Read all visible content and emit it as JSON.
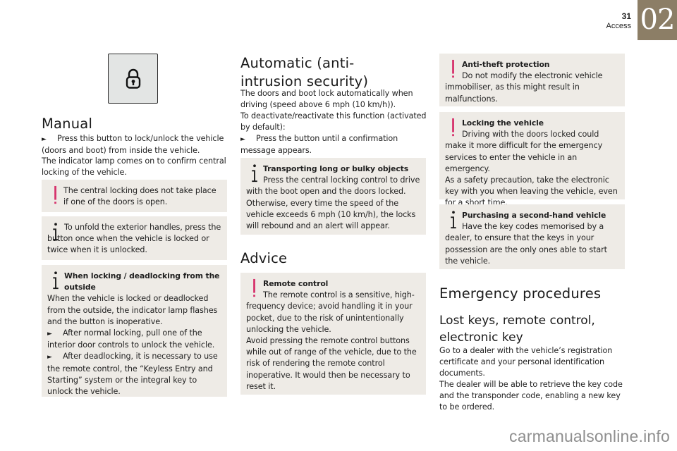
{
  "header": {
    "page_number": "31",
    "section": "Access",
    "chapter": "02"
  },
  "colors": {
    "chapter_tab": "#8c7e66",
    "box_background": "#eeebe6",
    "warning_icon": "#d6336c",
    "button_background": "#e3e5e4"
  },
  "icons": {
    "lock_button": "padlock-icon",
    "warning": "exclamation-icon",
    "info": "info-icon",
    "bullet": "triangle-right-icon"
  },
  "col1": {
    "heading": "Manual",
    "p1_bullet": "►",
    "p1": "Press this button to lock/unlock the vehicle (doors and boot) from inside the vehicle.",
    "p2": "The indicator lamp comes on to confirm central locking of the vehicle.",
    "warn1": "The central locking does not take place if one of the doors is open.",
    "info1": "To unfold the exterior handles, press the button once when the vehicle is locked or twice when it is unlocked.",
    "info2_title": "When locking / deadlocking from the outside",
    "info2_p1": "When the vehicle is locked or deadlocked from the outside, the indicator lamp flashes and the button is inoperative.",
    "info2_p2": "After normal locking, pull one of the interior door controls to unlock the vehicle.",
    "info2_p3": "After deadlocking, it is necessary to use the remote control, the “Keyless Entry and Starting” system or the integral key to unlock the vehicle."
  },
  "col2": {
    "heading": "Automatic (anti-intrusion security)",
    "p1": "The doors and boot lock automatically when driving (speed above 6 mph (10 km/h)).",
    "p2": "To deactivate/reactivate this function (activated by default):",
    "p3": "Press the button until a confirmation message appears.",
    "info_title": "Transporting long or bulky objects",
    "info_p1": "Press the central locking control to drive with the boot open and the doors locked.",
    "info_p2": "Otherwise, every time the speed of the vehicle exceeds 6 mph (10 km/h), the locks will rebound and an alert will appear.",
    "advice_heading": "Advice",
    "warn_title": "Remote control",
    "warn_p1": "The remote control is a sensitive, high-frequency device; avoid handling it in your pocket, due to the risk of unintentionally unlocking the vehicle.",
    "warn_p2": "Avoid pressing the remote control buttons while out of range of the vehicle, due to the risk of rendering the remote control inoperative. It would then be necessary to reset it."
  },
  "col3": {
    "warn1_title": "Anti-theft protection",
    "warn1_p1": "Do not modify the electronic vehicle immobiliser, as this might result in malfunctions.",
    "warn2_title": "Locking the vehicle",
    "warn2_p1": "Driving with the doors locked could make it more difficult for the emergency services to enter the vehicle in an emergency.",
    "warn2_p2": "As a safety precaution, take the electronic key with you when leaving the vehicle, even for a short time.",
    "info_title": "Purchasing a second-hand vehicle",
    "info_p1": "Have the key codes memorised by a dealer, to ensure that the keys in your possession are the only ones able to start the vehicle.",
    "heading": "Emergency procedures",
    "subheading": "Lost keys, remote control, electronic key",
    "p1": "Go to a dealer with the vehicle’s registration certificate and your personal identification documents.",
    "p2": "The dealer will be able to retrieve the key code and the transponder code, enabling a new key to be ordered."
  },
  "watermark": "carmanualsonline.info"
}
